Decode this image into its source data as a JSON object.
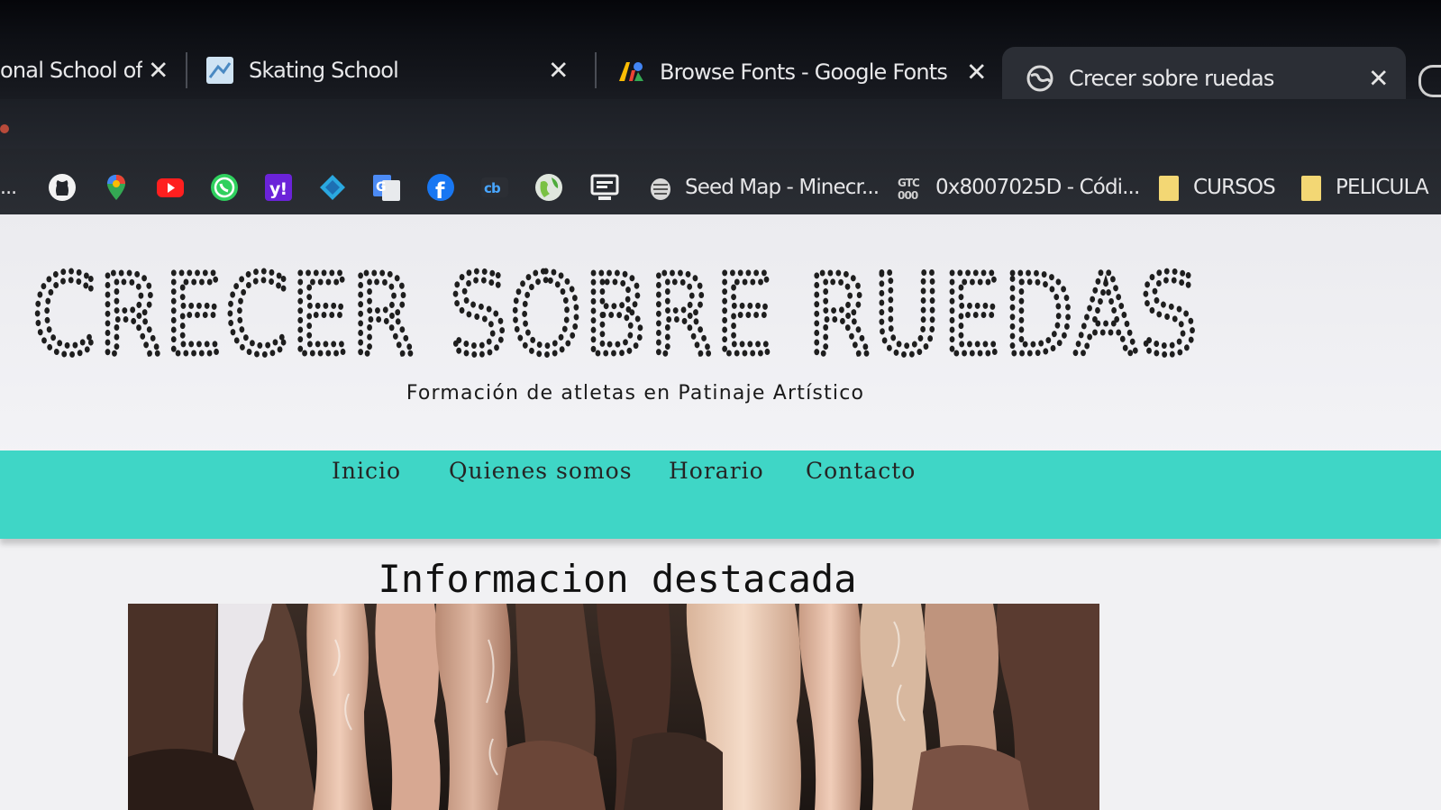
{
  "browser": {
    "tabs": [
      {
        "title": "onal School of",
        "icon": "page-icon",
        "active": false
      },
      {
        "title": "Skating School",
        "icon": "skating-school-favicon",
        "active": false
      },
      {
        "title": "Browse Fonts - Google Fonts",
        "icon": "google-fonts-favicon",
        "active": false
      },
      {
        "title": "Crecer sobre ruedas",
        "icon": "globe-icon",
        "active": true
      }
    ],
    "bookmarks": [
      {
        "icon": "github-icon"
      },
      {
        "icon": "maps-pin-icon"
      },
      {
        "icon": "youtube-icon"
      },
      {
        "icon": "whatsapp-icon"
      },
      {
        "icon": "yahoo-icon"
      },
      {
        "icon": "diamond-icon"
      },
      {
        "icon": "translate-icon"
      },
      {
        "icon": "facebook-icon"
      },
      {
        "icon": "cb-icon"
      },
      {
        "icon": "green-globe-icon"
      },
      {
        "icon": "monitor-icon"
      },
      {
        "icon": "seed-icon",
        "label": "Seed Map - Minecr..."
      },
      {
        "icon": "gtc-icon",
        "label": "0x8007025D - Códi..."
      },
      {
        "icon": "folder-icon",
        "label": "CURSOS"
      },
      {
        "icon": "folder-icon",
        "label": "PELICULA"
      }
    ]
  },
  "site": {
    "title": "CRECER SOBRE RUEDAS",
    "tagline": "Formación de atletas en Patinaje Artístico",
    "nav": [
      "Inicio",
      "Quienes somos",
      "Horario",
      "Contacto"
    ],
    "section_title": "Informacion destacada",
    "colors": {
      "nav_bg": "#3fd6c6",
      "page_bg": "#f1f1f3",
      "title_dots": "#1e1e1e"
    }
  }
}
